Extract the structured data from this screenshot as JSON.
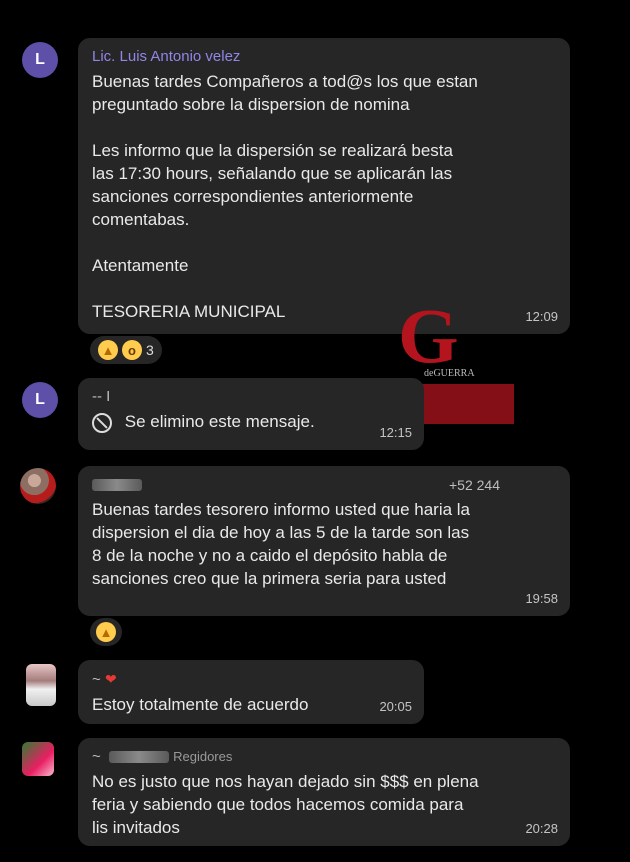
{
  "messages": [
    {
      "avatar_letter": "L",
      "sender": "Lic. Luis Antonio velez",
      "text": "Buenas tardes Compañeros a tod@s los que estan\npreguntado sobre la dispersion de nomina\n\nLes informo que la dispersión se realizará besta\nlas 17:30 hours, señalando que se aplicarán las\nsanciones correspondientes anteriormente\ncomentabas.\n\nAtentamente\n\nTESORERIA MUNICIPAL",
      "time": "12:09",
      "reaction_count": "3"
    },
    {
      "avatar_letter": "L",
      "sender": "-- I",
      "text": "Se elimino este mensaje.",
      "time": "12:15"
    },
    {
      "phone": "+52 244",
      "text": "Buenas tardes tesorero informo usted que haria la\ndispersion el dia de hoy a las 5 de la tarde son las\n8 de la noche y no a caido el depósito  habla de\nsanciones creo que la primera seria para usted",
      "time": "19:58"
    },
    {
      "sender": "~",
      "text": "Estoy totalmente de acuerdo",
      "time": "20:05"
    },
    {
      "sender": "~",
      "sender_suffix": "Regidores",
      "text": "No es justo que nos hayan dejado sin $$$ en plena\nferia y sabiendo que todos hacemos comida para\nlis invitados",
      "time": "20:28"
    }
  ],
  "watermark": {
    "letter": "G",
    "name": "deGUERRA"
  },
  "icons": {
    "deleted": "block-icon",
    "thumbs_up": "thumbs-up-emoji",
    "wow": "wow-emoji",
    "heart": "heart-emoji"
  },
  "colors": {
    "background": "#000000",
    "bubble": "#262626",
    "sender_purple": "#8f86e6",
    "avatar_purple": "#5e4fa8",
    "watermark_red": "#b3141d"
  }
}
